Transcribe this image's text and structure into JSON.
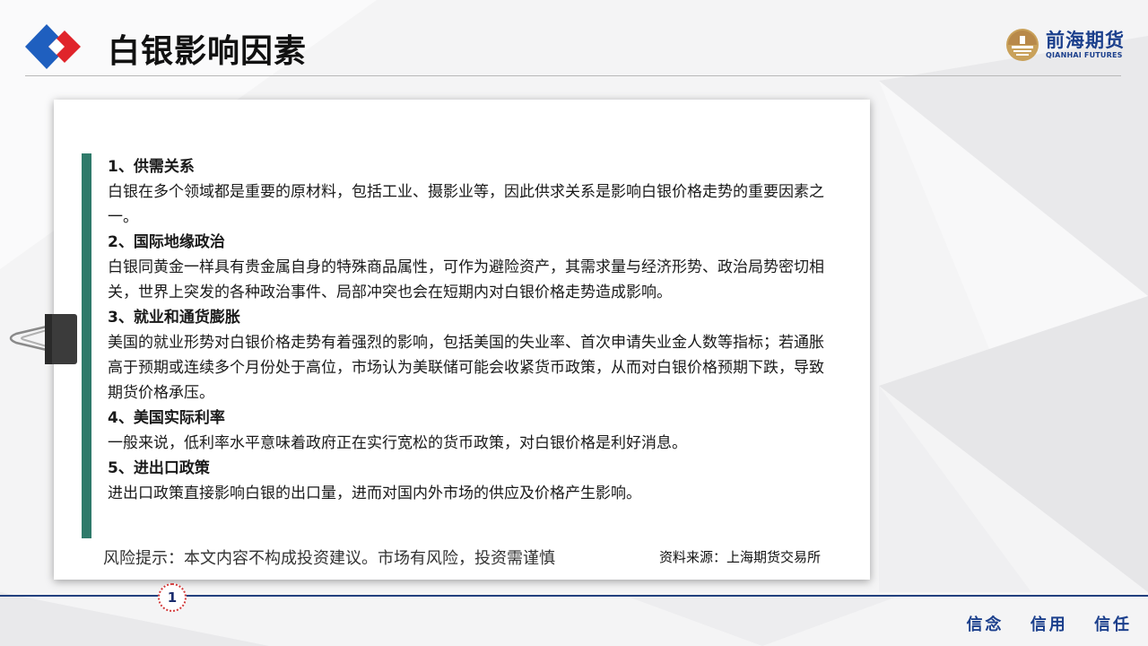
{
  "header": {
    "title": "白银影响因素",
    "brand_cn": "前海期货",
    "brand_en": "QIANHAI FUTURES"
  },
  "sections": [
    {
      "title": "1、供需关系",
      "body": "白银在多个领域都是重要的原材料，包括工业、摄影业等，因此供求关系是影响白银价格走势的重要因素之一。"
    },
    {
      "title": "2、国际地缘政治",
      "body": "白银同黄金一样具有贵金属自身的特殊商品属性，可作为避险资产，其需求量与经济形势、政治局势密切相关，世界上突发的各种政治事件、局部冲突也会在短期内对白银价格走势造成影响。"
    },
    {
      "title": "3、就业和通货膨胀",
      "body": "美国的就业形势对白银价格走势有着强烈的影响，包括美国的失业率、首次申请失业金人数等指标；若通胀高于预期或连续多个月份处于高位，市场认为美联储可能会收紧货币政策，从而对白银价格预期下跌，导致期货价格承压。"
    },
    {
      "title": "4、美国实际利率",
      "body": "一般来说，低利率水平意味着政府正在实行宽松的货币政策，对白银价格是利好消息。"
    },
    {
      "title": "5、进出口政策",
      "body": "进出口政策直接影响白银的出口量，进而对国内外市场的供应及价格产生影响。"
    }
  ],
  "footer": {
    "risk_note": "风险提示：本文内容不构成投资建议。市场有风险，投资需谨慎",
    "source": "资料来源：上海期货交易所",
    "page_number": "1",
    "slogan": [
      "信念",
      "信用",
      "信任"
    ]
  },
  "colors": {
    "accent_bar": "#2f7a6a",
    "brand_blue": "#1b3f8c",
    "logo_red": "#e0242b",
    "logo_blue": "#1f5fbf"
  }
}
